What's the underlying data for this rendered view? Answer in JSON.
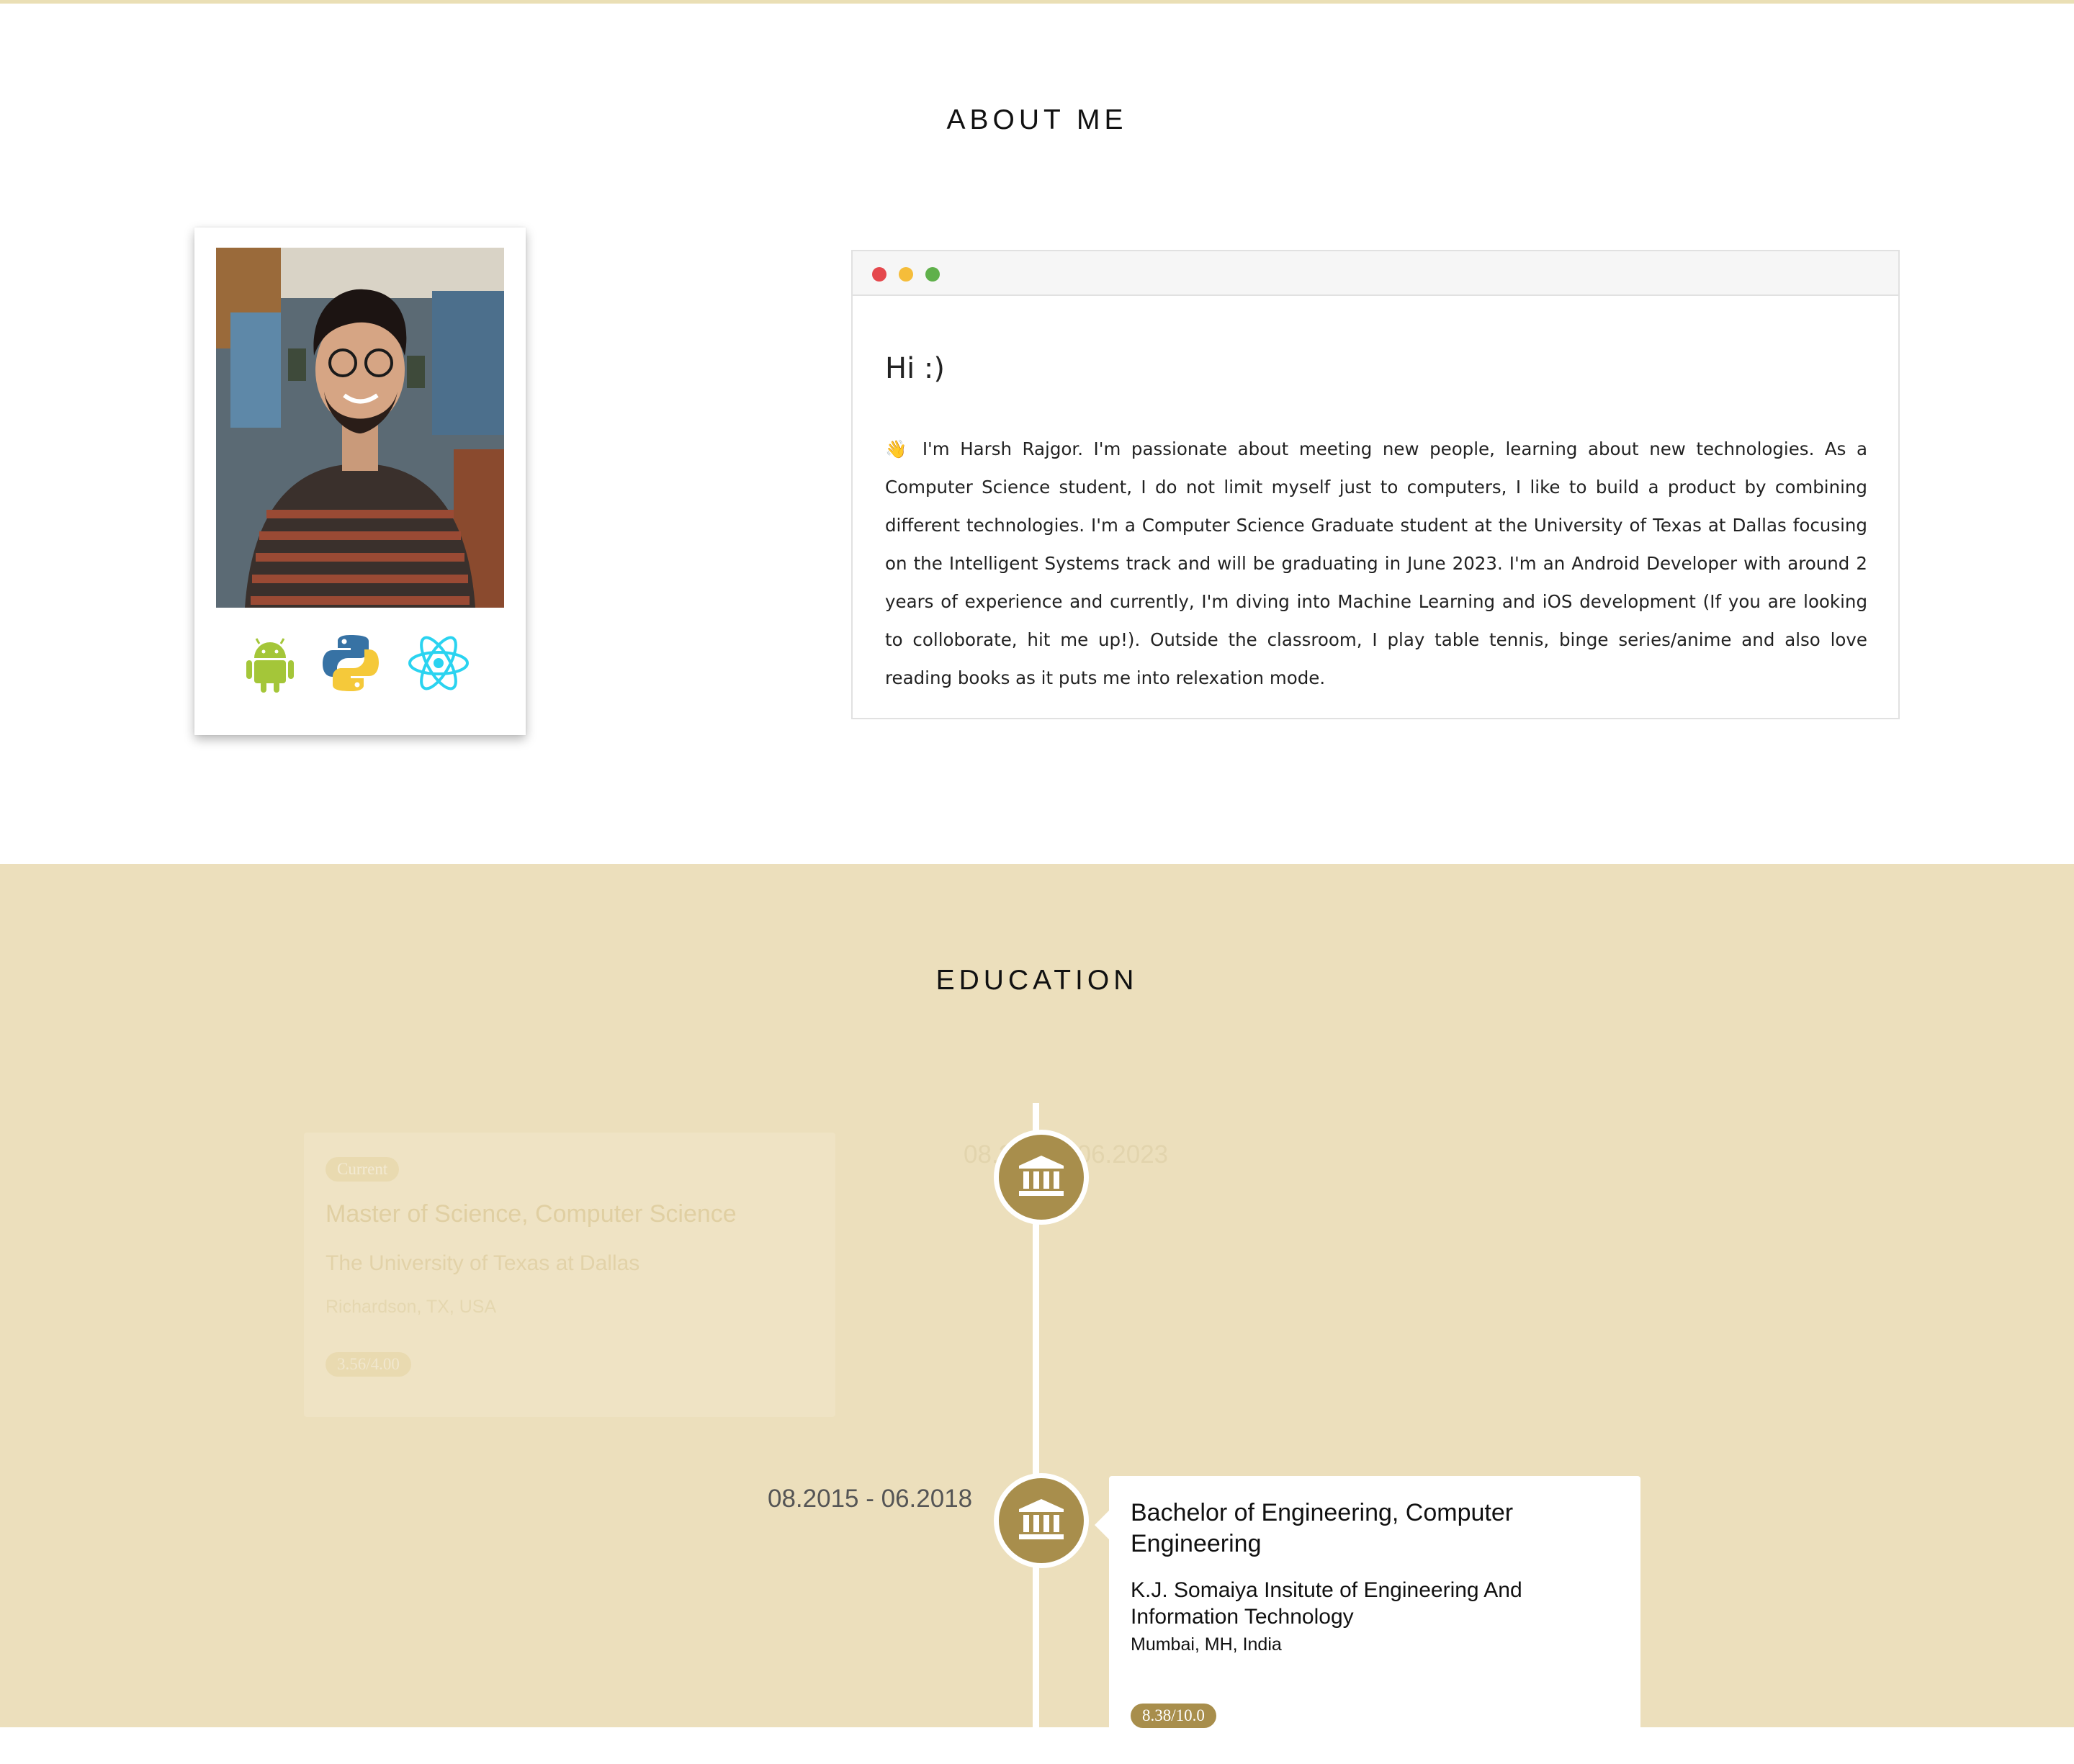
{
  "about": {
    "title": "ABOUT ME",
    "greeting": "Hi :)",
    "bio": "👋 I'm Harsh Rajgor. I'm passionate about meeting new people, learning about new technologies. As a Computer Science student, I do not limit myself just to computers, I like to build a product by combining different technologies. I'm a Computer Science Graduate student at the University of Texas at Dallas focusing on the Intelligent Systems track and will be graduating in June 2023. I'm an Android Developer with around 2 years of experience and currently, I'm diving into Machine Learning and iOS development (If you are looking to colloborate, hit me up!). Outside the classroom, I play table tennis, binge series/anime and also love reading books as it puts me into relexation mode.",
    "tech_icons": [
      "android-icon",
      "python-icon",
      "react-icon"
    ],
    "window_dots": [
      "#e5484d",
      "#f5bd3a",
      "#5fb04a"
    ]
  },
  "education": {
    "title": "EDUCATION",
    "entries": [
      {
        "status": "Current",
        "dates": "08.2021 - 06.2023",
        "degree": "Master of Science, Computer Science",
        "school": "The University of Texas at Dallas",
        "location": "Richardson, TX, USA",
        "gpa": "3.56/4.00"
      },
      {
        "dates": "08.2015 - 06.2018",
        "degree": "Bachelor of Engineering, Computer Engineering",
        "school": "K.J. Somaiya Insitute of Engineering And Information Technology",
        "location": "Mumbai, MH, India",
        "gpa": "8.38/10.0"
      }
    ],
    "node_icon": "institution-icon"
  },
  "colors": {
    "accent": "#a88e4c",
    "education_bg": "#ecdfbc",
    "top_border": "#eadfb5"
  }
}
